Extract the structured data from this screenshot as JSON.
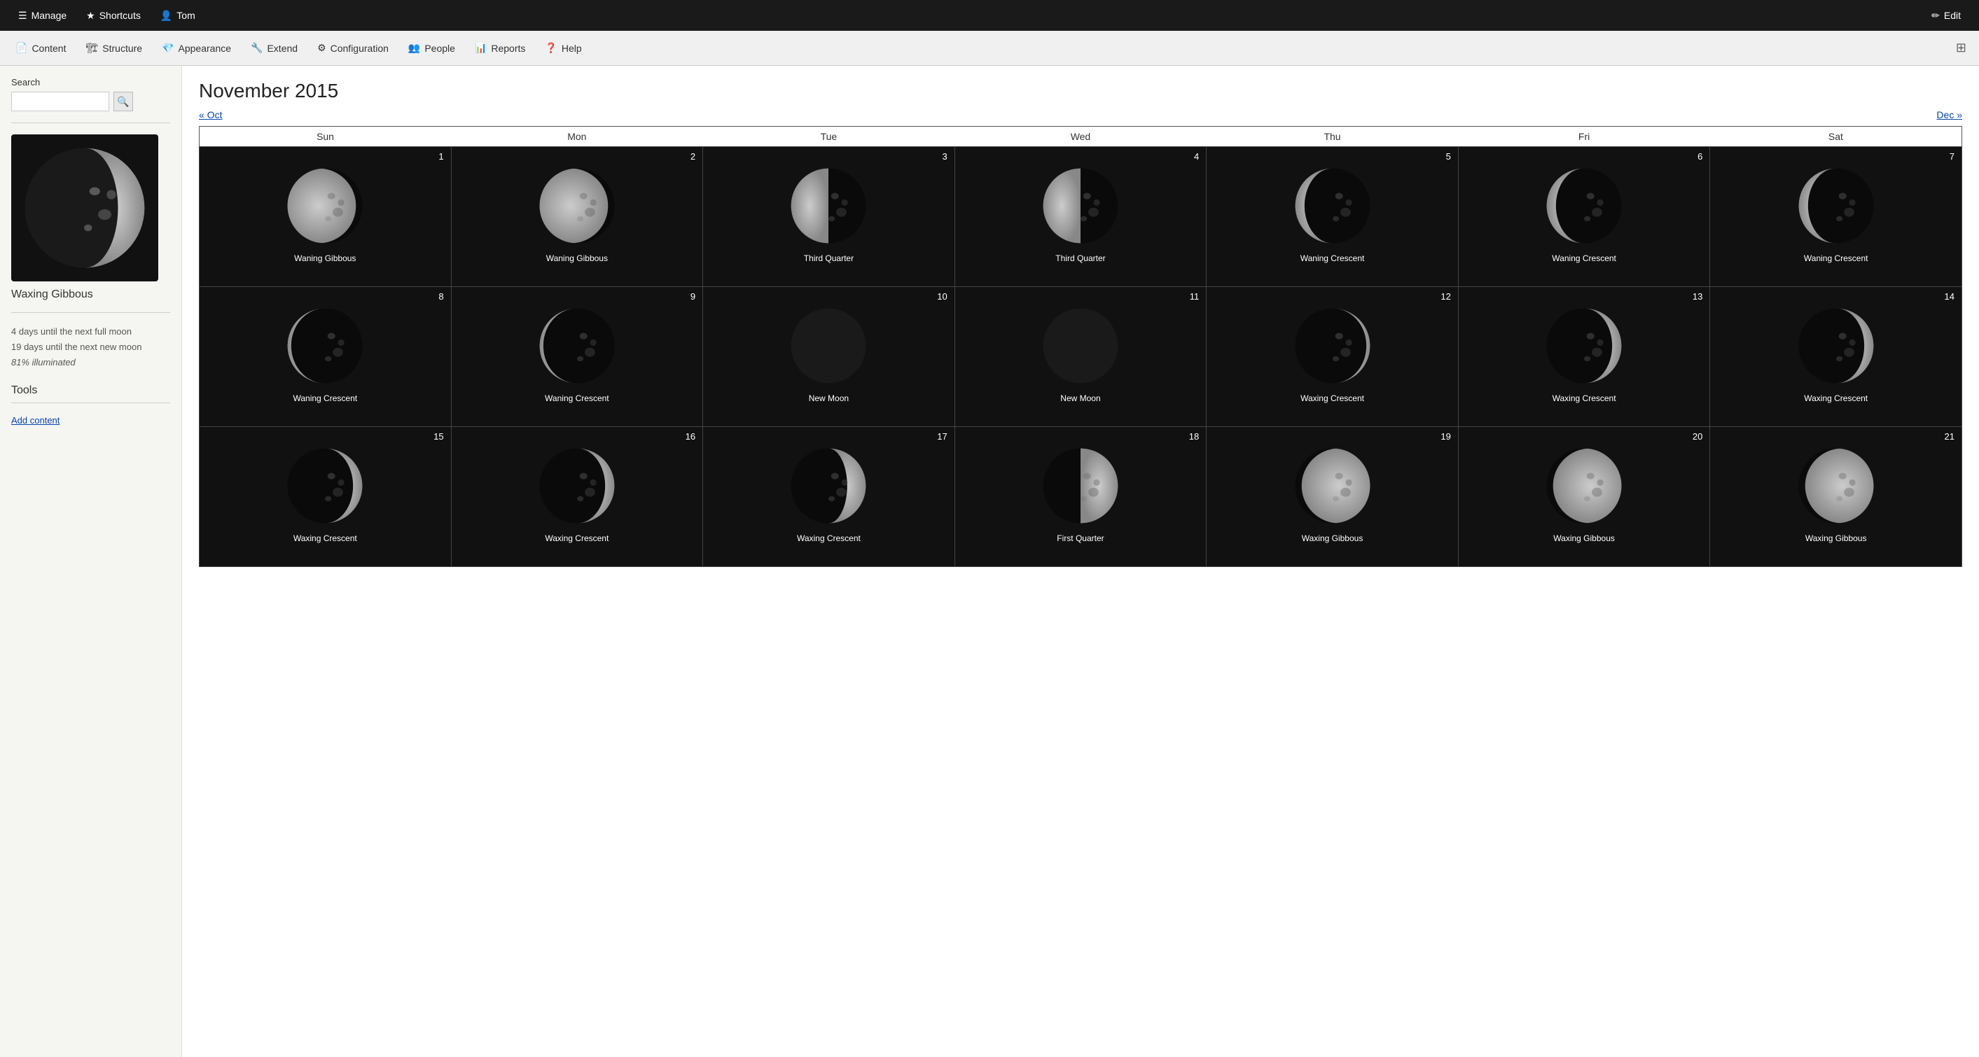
{
  "topbar": {
    "manage": "Manage",
    "shortcuts": "Shortcuts",
    "user": "Tom",
    "edit": "Edit"
  },
  "secondbar": {
    "items": [
      {
        "label": "Content",
        "icon": "📄"
      },
      {
        "label": "Structure",
        "icon": "🏗"
      },
      {
        "label": "Appearance",
        "icon": "💎"
      },
      {
        "label": "Extend",
        "icon": "🔧"
      },
      {
        "label": "Configuration",
        "icon": "⚙"
      },
      {
        "label": "People",
        "icon": "👤"
      },
      {
        "label": "Reports",
        "icon": "📊"
      },
      {
        "label": "Help",
        "icon": "❓"
      }
    ]
  },
  "sidebar": {
    "search_label": "Search",
    "search_placeholder": "",
    "moon_name": "Waxing Gibbous",
    "moon_info_1": "4 days until the next full moon",
    "moon_info_2": "19 days until the next new moon",
    "moon_info_3": "81% illuminated",
    "tools_title": "Tools",
    "add_content": "Add content"
  },
  "main": {
    "title": "November 2015",
    "prev_month": "« Oct",
    "next_month": "Dec »",
    "day_headers": [
      "Sun",
      "Mon",
      "Tue",
      "Wed",
      "Thu",
      "Fri",
      "Sat"
    ],
    "weeks": [
      [
        {
          "day": 1,
          "phase": "Waning Gibbous",
          "type": "waning-gibbous"
        },
        {
          "day": 2,
          "phase": "Waning Gibbous",
          "type": "waning-gibbous"
        },
        {
          "day": 3,
          "phase": "Third Quarter",
          "type": "third-quarter"
        },
        {
          "day": 4,
          "phase": "Third Quarter",
          "type": "third-quarter"
        },
        {
          "day": 5,
          "phase": "Waning Crescent",
          "type": "waning-crescent"
        },
        {
          "day": 6,
          "phase": "Waning Crescent",
          "type": "waning-crescent"
        },
        {
          "day": 7,
          "phase": "Waning Crescent",
          "type": "waning-crescent"
        }
      ],
      [
        {
          "day": 8,
          "phase": "Waning Crescent",
          "type": "waning-crescent-thin"
        },
        {
          "day": 9,
          "phase": "Waning Crescent",
          "type": "waning-crescent-thin"
        },
        {
          "day": 10,
          "phase": "New Moon",
          "type": "new-moon"
        },
        {
          "day": 11,
          "phase": "New Moon",
          "type": "new-moon"
        },
        {
          "day": 12,
          "phase": "Waxing Crescent",
          "type": "waxing-crescent-thin"
        },
        {
          "day": 13,
          "phase": "Waxing Crescent",
          "type": "waxing-crescent"
        },
        {
          "day": 14,
          "phase": "Waxing Crescent",
          "type": "waxing-crescent"
        }
      ],
      [
        {
          "day": 15,
          "phase": "Waxing Crescent",
          "type": "waxing-crescent"
        },
        {
          "day": 16,
          "phase": "Waxing Crescent",
          "type": "waxing-crescent"
        },
        {
          "day": 17,
          "phase": "Waxing Crescent",
          "type": "waxing-crescent-fat"
        },
        {
          "day": 18,
          "phase": "First Quarter",
          "type": "first-quarter"
        },
        {
          "day": 19,
          "phase": "Waxing Gibbous",
          "type": "waxing-gibbous"
        },
        {
          "day": 20,
          "phase": "Waxing Gibbous",
          "type": "waxing-gibbous"
        },
        {
          "day": 21,
          "phase": "Waxing Gibbous",
          "type": "waxing-gibbous"
        }
      ]
    ]
  }
}
